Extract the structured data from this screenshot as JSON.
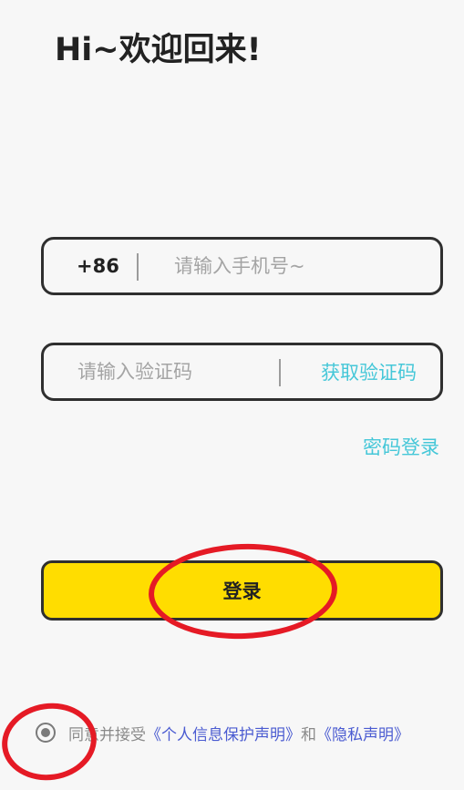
{
  "header": {
    "title": "Hi~欢迎回来!"
  },
  "phone": {
    "prefix": "+86",
    "placeholder": "请输入手机号~",
    "value": ""
  },
  "code": {
    "placeholder": "请输入验证码",
    "value": "",
    "get_code_label": "获取验证码"
  },
  "password_login_label": "密码登录",
  "login_button_label": "登录",
  "agreement": {
    "text_prefix": "同意并接受",
    "personal_info_link": "《个人信息保护声明》",
    "conjunction": "和",
    "privacy_link": "《隐私声明》",
    "checked": true
  },
  "colors": {
    "accent_button": "#ffdd00",
    "link_teal": "#45c7d8",
    "link_blue": "#4a5bd1",
    "annotation_red": "#e51a25"
  }
}
